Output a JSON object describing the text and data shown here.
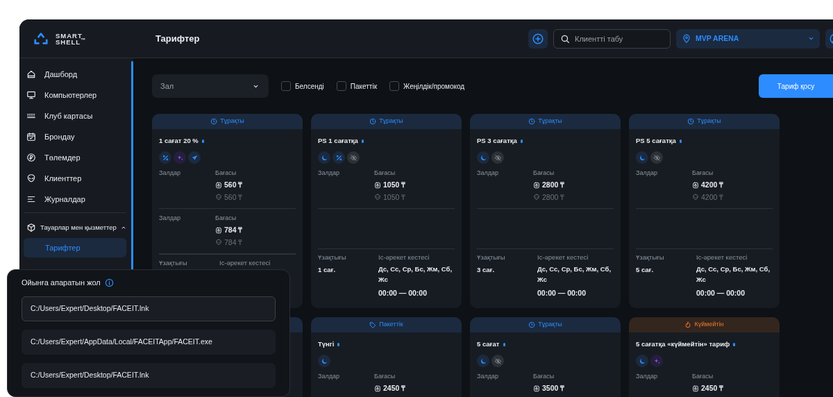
{
  "brand": {
    "line1": "SMART",
    "line2": "SHELL$^{™}$"
  },
  "header": {
    "title": "Тарифтер",
    "search": {
      "placeholder": "Клиентті табу"
    },
    "club": {
      "value": "MVP ARENA"
    }
  },
  "sidebar": {
    "items": [
      {
        "label": "Дашборд",
        "kind": "home",
        "selected": false
      },
      {
        "label": "Компьютерлер",
        "kind": "monitor",
        "selected": false
      },
      {
        "label": "Клуб картасы",
        "kind": "map",
        "selected": false
      },
      {
        "label": "Брондау",
        "kind": "calendar",
        "selected": false
      },
      {
        "label": "Төлемдер",
        "kind": "payment",
        "selected": false
      },
      {
        "label": "Клиенттер",
        "kind": "client",
        "selected": false
      },
      {
        "label": "Журналдар",
        "kind": "log",
        "selected": false
      }
    ],
    "group": {
      "label": "Тауарлар мен қызметтер",
      "expanded": true,
      "children": [
        {
          "label": "Тарифтер",
          "selected": true
        }
      ]
    }
  },
  "filters": {
    "hall": {
      "placeholder": "Зал"
    },
    "checkboxes": [
      {
        "label": "Белсенді",
        "checked": false
      },
      {
        "label": "Пакеттік",
        "checked": false
      },
      {
        "label": "Жеңілдік/промокод",
        "checked": false
      }
    ],
    "add_button": "Тариф қосу"
  },
  "cards": [
    {
      "kind": "regular",
      "header": "Тұрақты",
      "title": "1 сағат 20 %",
      "features": [
        {
          "kind": "percent"
        },
        {
          "kind": "sparkle"
        },
        {
          "kind": "send"
        }
      ],
      "prices": [
        {
          "halls_label": "Залдар",
          "price_label": "Бағасы",
          "price": "560 ₸",
          "price_alt": "560 ₸"
        },
        {
          "halls_label": "Залдар",
          "price_label": "Бағасы",
          "price": "784 ₸",
          "price_alt": "784 ₸"
        }
      ],
      "footer": {
        "duration_label": "Ұзақтығы",
        "schedule_label": "Іс-әрекет кестесі"
      }
    },
    {
      "kind": "regular",
      "header": "Тұрақты",
      "title": "PS 1 сағатқа",
      "features": [
        {
          "kind": "moon"
        },
        {
          "kind": "percent"
        },
        {
          "kind": "hidden"
        }
      ],
      "prices": [
        {
          "halls_label": "Залдар",
          "price_label": "Бағасы",
          "price": "1050 ₸",
          "price_alt": "1050 ₸"
        }
      ],
      "footer": {
        "duration_label": "Ұзақтығы",
        "duration": "1 сағ.",
        "schedule_label": "Іс-әрекет кестесі",
        "schedule": "Дс, Сс, Ср, Бс, Жм, Сб, Жс",
        "time": "00:00 — 00:00"
      }
    },
    {
      "kind": "regular",
      "header": "Тұрақты",
      "title": "PS 3 сағатқа",
      "features": [
        {
          "kind": "moon"
        },
        {
          "kind": "hidden"
        }
      ],
      "prices": [
        {
          "halls_label": "Залдар",
          "price_label": "Бағасы",
          "price": "2800 ₸",
          "price_alt": "2800 ₸"
        }
      ],
      "footer": {
        "duration_label": "Ұзақтығы",
        "duration": "3 сағ.",
        "schedule_label": "Іс-әрекет кестесі",
        "schedule": "Дс, Сс, Ср, Бс, Жм, Сб, Жс",
        "time": "00:00 — 00:00"
      }
    },
    {
      "kind": "regular",
      "header": "Тұрақты",
      "title": "PS 5 сағатқа",
      "features": [
        {
          "kind": "moon"
        },
        {
          "kind": "hidden"
        }
      ],
      "prices": [
        {
          "halls_label": "Залдар",
          "price_label": "Бағасы",
          "price": "4200 ₸",
          "price_alt": "4200 ₸"
        }
      ],
      "footer": {
        "duration_label": "Ұзақтығы",
        "duration": "5 сағ.",
        "schedule_label": "Іс-әрекет кестесі",
        "schedule": "Дс, Сс, Ср, Бс, Жм, Сб, Жс",
        "time": "00:00 — 00:00"
      }
    },
    {
      "kind": "package",
      "header": "Пакеттік",
      "title": "Түнгі",
      "features": [
        {
          "kind": "moon"
        }
      ],
      "prices": [
        {
          "halls_label": "Залдар",
          "price_label": "Бағасы",
          "price": "2450 ₸"
        }
      ]
    },
    {
      "kind": "regular",
      "header": "Тұрақты",
      "title": "5 сағат",
      "features": [
        {
          "kind": "moon"
        },
        {
          "kind": "hidden"
        }
      ],
      "prices": [
        {
          "halls_label": "Залдар",
          "price_label": "Бағасы",
          "price": "3500 ₸"
        }
      ]
    },
    {
      "kind": "hot",
      "header": "Күймейтін",
      "title": "5 сағатқа «күймейтін» тариф",
      "features": [
        {
          "kind": "moon"
        },
        {
          "kind": "sparkle"
        }
      ],
      "prices": [
        {
          "halls_label": "Залдар",
          "price_label": "Бағасы",
          "price": "2450 ₸"
        }
      ]
    }
  ],
  "path_popup": {
    "title": "Ойынға апаратын жол",
    "paths": [
      {
        "value": "C:/Users/Expert/Desktop/FACEIT.lnk",
        "selected": true
      },
      {
        "value": "C:/Users/Expert/AppData/Local/FACEITApp/FACEIT.exe",
        "selected": false
      },
      {
        "value": "C:/Users/Expert/Desktop/FACEIT.lnk",
        "selected": false
      }
    ]
  }
}
